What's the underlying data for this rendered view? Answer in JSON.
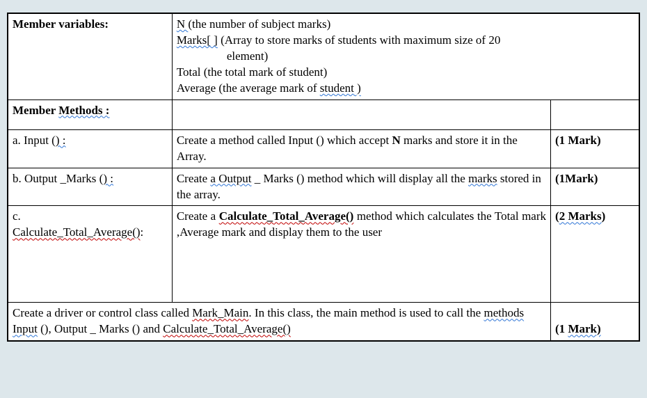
{
  "vars": {
    "label": "Member variables:",
    "line1_a": "N ",
    "line1_b": "(the number of subject marks)",
    "line2_a": "Marks[ ]",
    "line2_b": " (Array to store marks of students  with maximum  size of 20",
    "line2_indent": "element)",
    "line3": "Total (the total mark of student)",
    "line4_a": "Average (the average mark of ",
    "line4_b": "student )"
  },
  "methods_hdr": {
    "label_a": "Member ",
    "label_b": "Methods :"
  },
  "rows": [
    {
      "name_a": "a. Input (",
      "name_b": ") :",
      "desc_a": "Create a method called Input () which accept ",
      "desc_N": "N",
      "desc_b": " marks and store it in the Array.",
      "mark": "(1 Mark)"
    },
    {
      "name_a": "b. Output _Marks (",
      "name_b": ") :",
      "desc_a": "Create ",
      "desc_sq": "a  Output",
      "desc_b": " _ Marks () method which will display  all the ",
      "desc_sq2": "marks",
      "desc_c": " stored in the array.",
      "mark": "(1Mark)"
    },
    {
      "name_plain": "c.",
      "name_sq": "Calculate_Total_Average()",
      "name_tail": ":",
      "desc_a": "Create  a  ",
      "desc_sq": "Calculate_Total_Average()",
      "desc_b": "  method  which calculates the Total mark ,Average mark and display them to the user",
      "mark_a": "(",
      "mark_sq": "2  Marks",
      "mark_b": ")"
    }
  ],
  "footer": {
    "text_a": "Create a driver or control class called ",
    "sq1": "Mark_Main",
    "text_b": ". In this class, the main method is used to call the ",
    "sq2": "methods  Input",
    "text_c": " (),   Output _ Marks  () and  ",
    "sq3": "Calculate_Total_Average()",
    "mark_a": "(1 ",
    "mark_sq": "Mark)"
  }
}
